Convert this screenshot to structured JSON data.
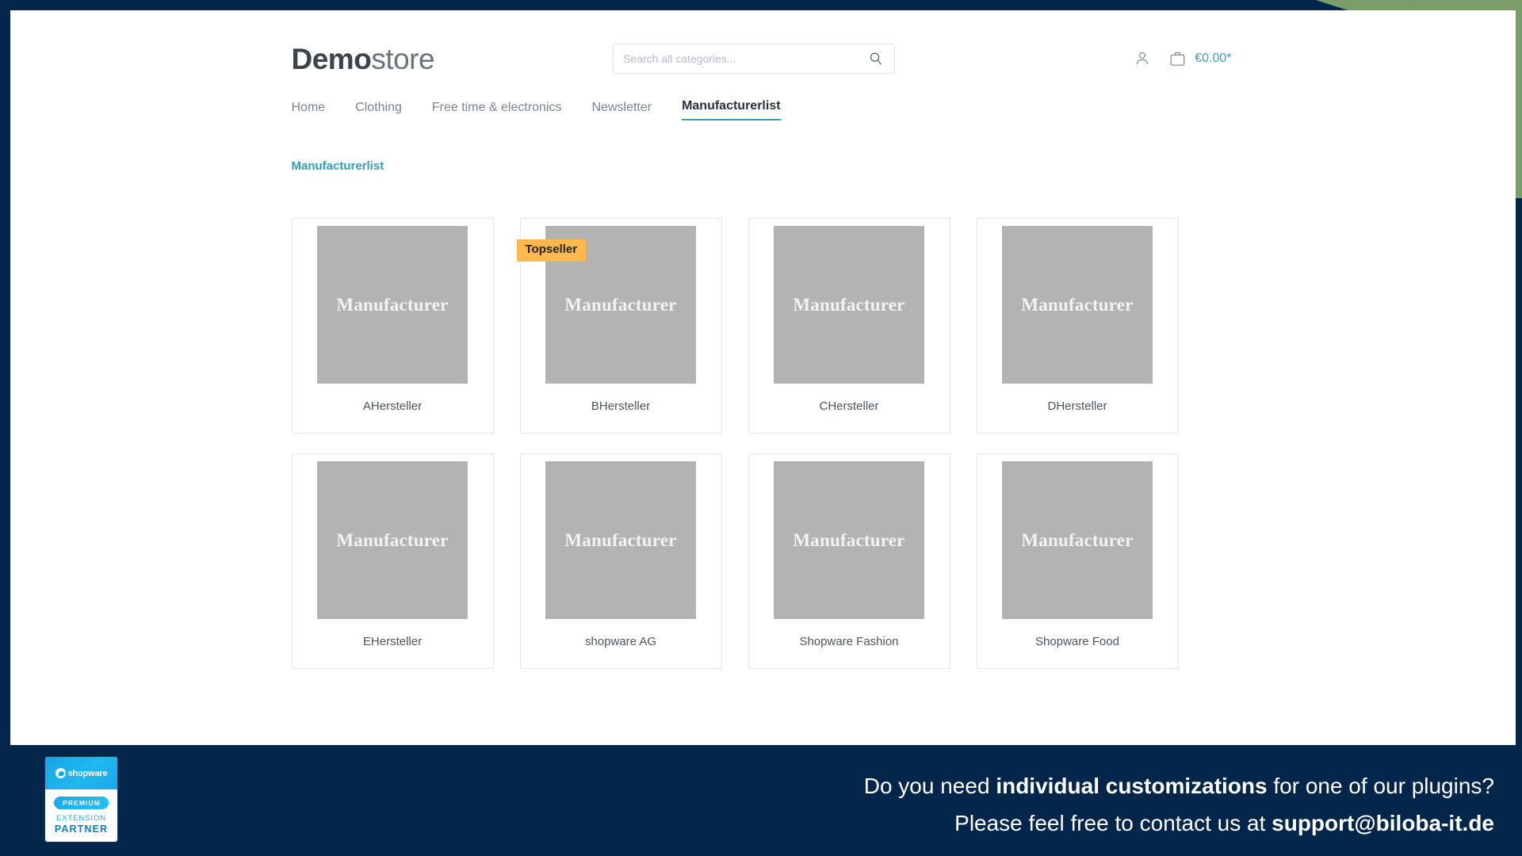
{
  "theme": {
    "frame_navy": "#04264b",
    "accent_green": "#7a9d69",
    "brand_teal": "#3a9fb5",
    "badge_orange": "#ffb84d",
    "thumb_gray": "#b3b3b3"
  },
  "header": {
    "brand_strong": "Demo",
    "brand_light": "store",
    "search": {
      "placeholder": "Search all categories...",
      "value": "",
      "icon": "search-icon"
    },
    "actions": {
      "account_icon": "user-icon",
      "cart_icon": "bag-icon",
      "cart_total": "€0.00*"
    },
    "nav": [
      {
        "label": "Home",
        "active": false
      },
      {
        "label": "Clothing",
        "active": false
      },
      {
        "label": "Free time & electronics",
        "active": false
      },
      {
        "label": "Newsletter",
        "active": false
      },
      {
        "label": "Manufacturerlist",
        "active": true
      }
    ]
  },
  "breadcrumb": {
    "label": "Manufacturerlist"
  },
  "manufacturers": [
    {
      "name": "AHersteller",
      "thumb_label": "Manufacturer",
      "badge": ""
    },
    {
      "name": "BHersteller",
      "thumb_label": "Manufacturer",
      "badge": "Topseller"
    },
    {
      "name": "CHersteller",
      "thumb_label": "Manufacturer",
      "badge": ""
    },
    {
      "name": "DHersteller",
      "thumb_label": "Manufacturer",
      "badge": ""
    },
    {
      "name": "EHersteller",
      "thumb_label": "Manufacturer",
      "badge": ""
    },
    {
      "name": "shopware AG",
      "thumb_label": "Manufacturer",
      "badge": ""
    },
    {
      "name": "Shopware Fashion",
      "thumb_label": "Manufacturer",
      "badge": ""
    },
    {
      "name": "Shopware Food",
      "thumb_label": "Manufacturer",
      "badge": ""
    }
  ],
  "bottom_banner": {
    "partner_badge": {
      "logo_text": "shopware",
      "pill": "PREMIUM",
      "line1": "EXTENSION",
      "line2": "PARTNER"
    },
    "line1_a": "Do you need ",
    "line1_b": "individual customizations",
    "line1_c": " for one of our plugins?",
    "line2_a": "Please feel free to contact us at ",
    "line2_b": "support@biloba-it.de"
  }
}
